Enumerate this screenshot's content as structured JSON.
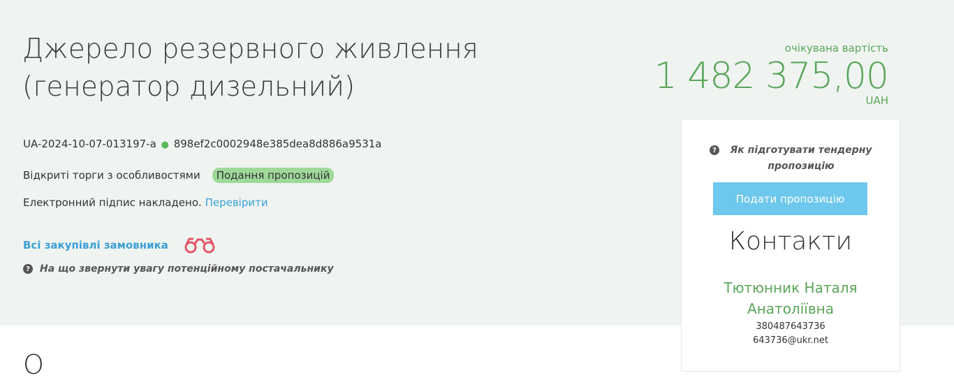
{
  "tender": {
    "title": "Джерело резервного живлення (генератор дизельний)",
    "tender_id": "UA-2024-10-07-013197-a",
    "separator": "●",
    "hash": "898ef2c0002948e385dea8d886a9531a",
    "procedure_type": "Відкриті торги з особливостями",
    "status": "Подання пропозицій",
    "signature_text": "Електронний підпис накладено.",
    "verify_link": "Перевірити",
    "all_purchases_link": "Всі закупівлі замовника",
    "attention_text": "На що звернути увагу потенційному постачальнику"
  },
  "price": {
    "label": "очікувана вартість",
    "amount": "1 482 375,00",
    "currency": "UAH"
  },
  "panel": {
    "howto_text": "Як підготувати тендерну пропозицію",
    "submit_button": "Подати пропозицію",
    "contacts_title": "Контакти",
    "contact_name": "Тютюнник Наталя Анатоліївна",
    "phone": "380487643736",
    "email": "643736@ukr.net"
  },
  "next_section": {
    "heading_partial": "О"
  },
  "icons": {
    "question": "question-circle-icon",
    "binoculars": "binoculars-icon"
  },
  "colors": {
    "background": "#eff4f1",
    "accent_green": "#5aa55a",
    "link_blue": "#3a9fd6",
    "badge_green": "#9fd99a",
    "button_blue": "#6ec7ec",
    "binoculars_red": "#e0556a"
  }
}
